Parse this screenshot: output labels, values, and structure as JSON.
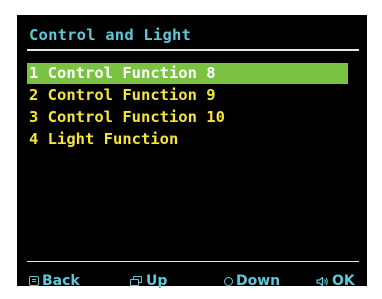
{
  "header": {
    "title": "Control and Light"
  },
  "menu": {
    "items": [
      {
        "label": "1 Control Function 8",
        "selected": true
      },
      {
        "label": "2 Control Function 9",
        "selected": false
      },
      {
        "label": "3 Control Function 10",
        "selected": false
      },
      {
        "label": "4 Light Function",
        "selected": false
      }
    ]
  },
  "footer": {
    "back": {
      "label": "Back",
      "icon": "menu-icon"
    },
    "up": {
      "label": "Up",
      "icon": "layers-icon"
    },
    "down": {
      "label": "Down",
      "icon": "circle-icon"
    },
    "ok": {
      "label": "OK",
      "icon": "speaker-icon"
    }
  },
  "colors": {
    "background": "#000000",
    "title": "#5ec8d8",
    "item_text": "#f4e53a",
    "selected_bg": "#7cc242",
    "selected_text": "#ffffff",
    "footer_text": "#5ec8d8"
  }
}
